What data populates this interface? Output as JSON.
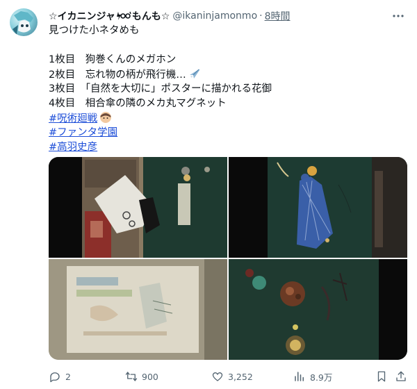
{
  "tweet": {
    "display_name": "☆イカニンジャ",
    "display_name_suffix": "もんも☆",
    "handle": "@ikaninjamonmo",
    "separator": "·",
    "time": "8時間",
    "lines": [
      "見つけた小ネタめも",
      "1枚目　狗巻くんのメガホン",
      "2枚目　忘れ物の柄が飛行機…",
      "3枚目　「自然を大切に」ポスターに描かれる花御",
      "4枚目　相合傘の隣のメカ丸マグネット"
    ],
    "hashtags": [
      "#呪術廻戦",
      "#ファンタ学園",
      "#高羽史彦"
    ]
  },
  "icons": {
    "avatar": "avatar-illustration",
    "more": "more-horizontal-icon",
    "reply": "reply-icon",
    "retweet": "retweet-icon",
    "like": "heart-icon",
    "views": "views-chart-icon",
    "bookmark": "bookmark-icon",
    "share": "share-icon"
  },
  "media": {
    "count": 4
  },
  "metrics": {
    "replies": "2",
    "retweets": "900",
    "likes": "3,252",
    "views": "8.9万"
  },
  "colors": {
    "text": "#0f1419",
    "secondary": "#536471",
    "link": "#1d4ed8"
  }
}
